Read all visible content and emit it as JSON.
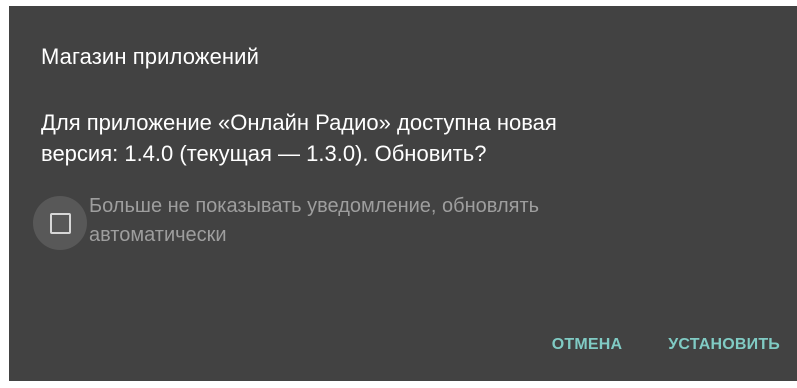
{
  "dialog": {
    "title": "Магазин приложений",
    "message_line1": "Для приложение «Онлайн Радио» доступна новая",
    "message_line2": "версия: 1.4.0 (текущая — 1.3.0). Обновить?",
    "checkbox": {
      "label_line1": "Больше не показывать уведомление, обновлять",
      "label_line2": "автоматически",
      "checked": false
    },
    "buttons": {
      "cancel_label": "ОТМЕНА",
      "install_label": "УСТАНОВИТЬ"
    }
  },
  "colors": {
    "dialog_background": "#424242",
    "accent": "#80cbc4",
    "text_primary": "#ffffff",
    "text_disabled": "#9e9e9e"
  }
}
